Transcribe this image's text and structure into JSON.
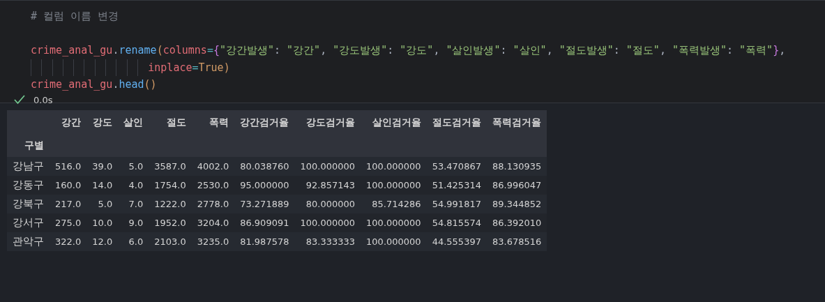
{
  "code": {
    "lines": [
      {
        "kind": "code",
        "tokens": [
          {
            "text": "# 컬럼 이름 변경",
            "kind": "comment"
          }
        ]
      },
      {
        "kind": "blank"
      },
      {
        "kind": "code",
        "tokens": [
          {
            "text": "crime_anal_gu",
            "kind": "variable"
          },
          {
            "text": ".",
            "kind": "punct"
          },
          {
            "text": "rename",
            "kind": "method"
          },
          {
            "text": "(",
            "kind": "paren"
          },
          {
            "text": "columns",
            "kind": "variable"
          },
          {
            "text": "=",
            "kind": "operator"
          },
          {
            "text": "{",
            "kind": "brace"
          },
          {
            "text": "\"강간발생\"",
            "kind": "string"
          },
          {
            "text": ": ",
            "kind": "punct"
          },
          {
            "text": "\"강간\"",
            "kind": "string"
          },
          {
            "text": ", ",
            "kind": "punct"
          },
          {
            "text": "\"강도발생\"",
            "kind": "string"
          },
          {
            "text": ": ",
            "kind": "punct"
          },
          {
            "text": "\"강도\"",
            "kind": "string"
          },
          {
            "text": ", ",
            "kind": "punct"
          },
          {
            "text": "\"살인발생\"",
            "kind": "string"
          },
          {
            "text": ": ",
            "kind": "punct"
          },
          {
            "text": "\"살인\"",
            "kind": "string"
          },
          {
            "text": ", ",
            "kind": "punct"
          },
          {
            "text": "\"절도발생\"",
            "kind": "string"
          },
          {
            "text": ": ",
            "kind": "punct"
          },
          {
            "text": "\"절도\"",
            "kind": "string"
          },
          {
            "text": ", ",
            "kind": "punct"
          },
          {
            "text": "\"폭력발생\"",
            "kind": "string"
          },
          {
            "text": ": ",
            "kind": "punct"
          },
          {
            "text": "\"폭력\"",
            "kind": "string"
          },
          {
            "text": "}",
            "kind": "brace"
          },
          {
            "text": ",",
            "kind": "punct"
          }
        ]
      },
      {
        "kind": "continued",
        "tokens": [
          {
            "text": "inplace",
            "kind": "variable"
          },
          {
            "text": "=",
            "kind": "operator"
          },
          {
            "text": "True",
            "kind": "constant"
          },
          {
            "text": ")",
            "kind": "paren"
          }
        ]
      },
      {
        "kind": "code",
        "tokens": [
          {
            "text": "crime_anal_gu",
            "kind": "variable"
          },
          {
            "text": ".",
            "kind": "punct"
          },
          {
            "text": "head",
            "kind": "method"
          },
          {
            "text": "()",
            "kind": "paren"
          }
        ]
      }
    ]
  },
  "status": {
    "success": true,
    "time": "0.0s"
  },
  "table": {
    "columns": [
      "강간",
      "강도",
      "살인",
      "절도",
      "폭력",
      "강간검거율",
      "강도검거율",
      "살인검거율",
      "절도검거율",
      "폭력검거율"
    ],
    "index_name": "구별",
    "rows": [
      {
        "label": "강남구",
        "cells": [
          "516.0",
          "39.0",
          "5.0",
          "3587.0",
          "4002.0",
          "80.038760",
          "100.000000",
          "100.000000",
          "53.470867",
          "88.130935"
        ]
      },
      {
        "label": "강동구",
        "cells": [
          "160.0",
          "14.0",
          "4.0",
          "1754.0",
          "2530.0",
          "95.000000",
          "92.857143",
          "100.000000",
          "51.425314",
          "86.996047"
        ]
      },
      {
        "label": "강북구",
        "cells": [
          "217.0",
          "5.0",
          "7.0",
          "1222.0",
          "2778.0",
          "73.271889",
          "80.000000",
          "85.714286",
          "54.991817",
          "89.344852"
        ]
      },
      {
        "label": "강서구",
        "cells": [
          "275.0",
          "10.0",
          "9.0",
          "1952.0",
          "3204.0",
          "86.909091",
          "100.000000",
          "100.000000",
          "54.815574",
          "86.392010"
        ]
      },
      {
        "label": "관악구",
        "cells": [
          "322.0",
          "12.0",
          "6.0",
          "2103.0",
          "3235.0",
          "81.987578",
          "83.333333",
          "100.000000",
          "44.555397",
          "83.678516"
        ]
      }
    ]
  }
}
